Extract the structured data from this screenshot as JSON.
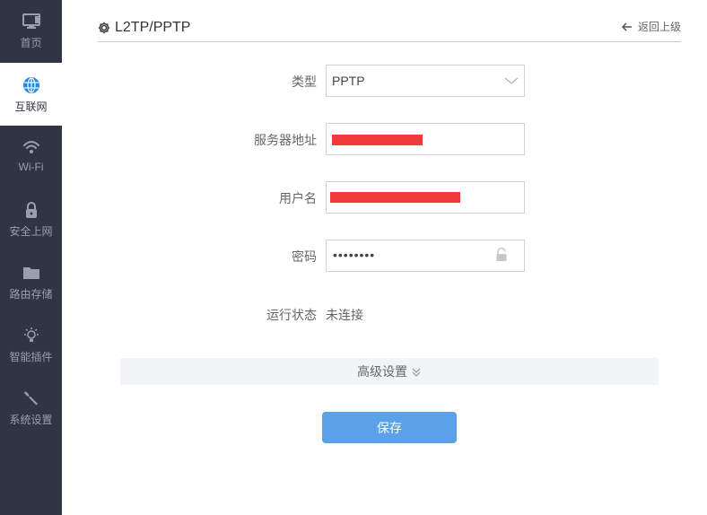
{
  "sidebar": {
    "items": [
      {
        "label": "首页",
        "icon": "monitor-icon"
      },
      {
        "label": "互联网",
        "icon": "globe-icon",
        "active": true
      },
      {
        "label": "Wi-Fi",
        "icon": "wifi-icon"
      },
      {
        "label": "安全上网",
        "icon": "lock-icon"
      },
      {
        "label": "路由存储",
        "icon": "folder-icon"
      },
      {
        "label": "智能插件",
        "icon": "lightbulb-icon"
      },
      {
        "label": "系统设置",
        "icon": "wrench-icon"
      }
    ]
  },
  "header": {
    "title": "L2TP/PPTP",
    "back_label": "返回上级"
  },
  "form": {
    "type_label": "类型",
    "type_value": "PPTP",
    "server_label": "服务器地址",
    "username_label": "用户名",
    "password_label": "密码",
    "password_mask": "••••••••",
    "status_label": "运行状态",
    "status_value": "未连接"
  },
  "advanced": {
    "label": "高级设置"
  },
  "save_label": "保存",
  "colors": {
    "sidebar_bg": "#2f3541",
    "accent": "#5aa1ea",
    "redaction": "#f23a3a"
  }
}
